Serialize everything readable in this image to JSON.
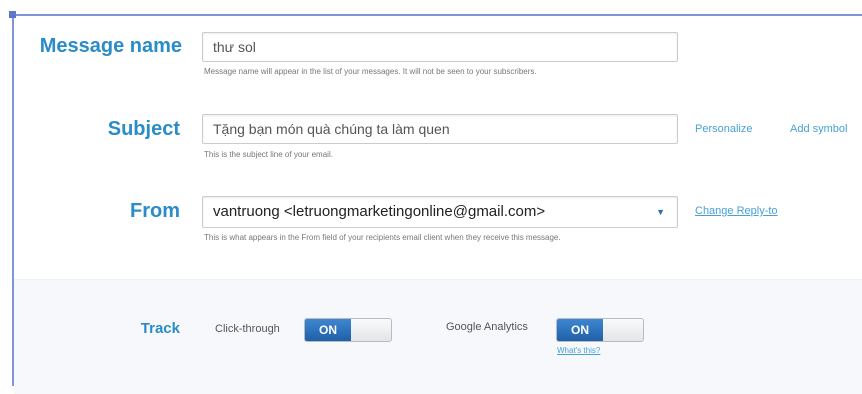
{
  "message_name": {
    "label": "Message name",
    "value": "thư sol",
    "help": "Message name will appear in the list of your messages. It will not be seen to your subscribers."
  },
  "subject": {
    "label": "Subject",
    "value": "Tặng bạn món quà chúng ta làm quen",
    "help": "This is the subject line of your email.",
    "personalize_link": "Personalize",
    "add_symbol_link": "Add symbol"
  },
  "from": {
    "label": "From",
    "value": "vantruong <letruongmarketingonline@gmail.com>",
    "help": "This is what appears in the From field of your recipients email client when they receive this message.",
    "change_reply_to_link": "Change Reply-to"
  },
  "track": {
    "label": "Track",
    "click_through": {
      "label": "Click-through",
      "state": "ON"
    },
    "google_analytics": {
      "label": "Google Analytics",
      "state": "ON",
      "whats_this": "What's this?"
    }
  },
  "colors": {
    "accent": "#2a8cc8",
    "frame": "#7e95d6",
    "toggle_on": "#1f5fa8",
    "link": "#48a1d4"
  },
  "icons": {
    "select_caret": "dropdown-caret-icon"
  }
}
